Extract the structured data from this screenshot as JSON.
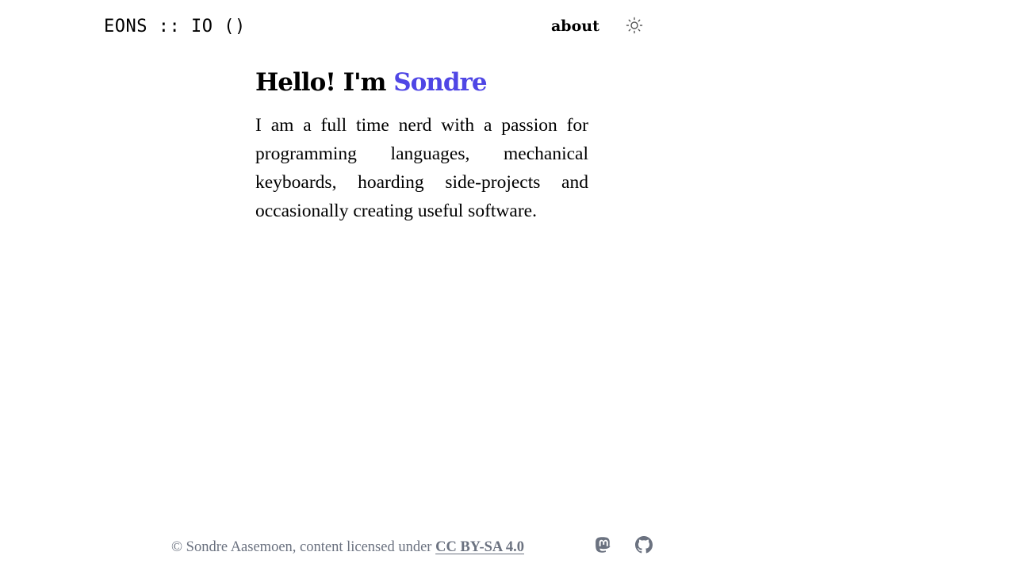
{
  "header": {
    "site_title": "EONS :: IO ()",
    "nav": [
      {
        "label": "about"
      }
    ],
    "theme_toggle_icon": "sun-icon"
  },
  "main": {
    "greeting": "Hello! I'm",
    "name": "Sondre",
    "intro": "I am a full time nerd with a passion for programming languages, mechanical keyboards, hoarding side-projects and occasionally creating useful software."
  },
  "footer": {
    "copyright": "© Sondre Aasemoen, content licensed under",
    "license_link": "CC BY-SA 4.0",
    "social": [
      {
        "icon": "mastodon-icon"
      },
      {
        "icon": "github-icon"
      }
    ]
  },
  "colors": {
    "accent": "#4f46e5",
    "muted_text": "#6b7280",
    "text": "#000000",
    "background": "#ffffff"
  }
}
